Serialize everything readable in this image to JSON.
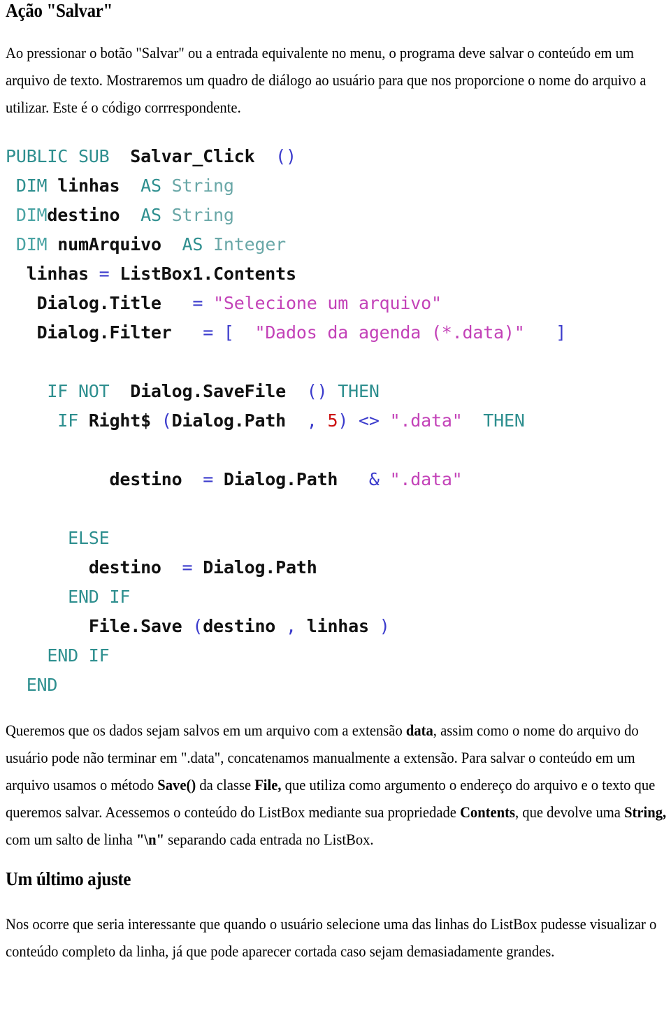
{
  "document": {
    "heading_1": "Ação \"Salvar\"",
    "heading_2": "Um último ajuste",
    "intro_paragraph": "Ao pressionar o botão \"Salvar\" ou a entrada equivalente no menu, o programa deve salvar o conteúdo em um arquivo de texto. Mostraremos um quadro de diálogo ao usuário para que nos proporcione o nome do arquivo a utilizar. Este é o código corrrespondente.",
    "closing_paragraph": "Nos ocorre que seria interessante que quando o usuário selecione uma das linhas do ListBox pudesse visualizar o conteúdo completo da linha, já que pode aparecer cortada caso sejam demasiadamente grandes."
  },
  "explanation": {
    "p1_a": "Queremos que os dados sejam salvos em um arquivo com a extensão ",
    "p1_b_bold": "data",
    "p1_c": ", assim como o nome do arquivo do usuário pode não terminar em \".data\", concatenamos manualmente a extensão. Para salvar o conteúdo em um arquivo usamos o método ",
    "p1_d_bold": "Save()",
    "p1_e": " da classe ",
    "p1_f_bold": "File,",
    "p1_g": " que utiliza como argumento o endereço do arquivo e o texto que queremos salvar. Acessemos o conteúdo do ListBox mediante sua propriedade ",
    "p1_h_bold": "Contents",
    "p1_i": ", que devolve uma ",
    "p1_j_bold": "String,",
    "p1_k": " com um salto de linha ",
    "p1_l_bold": "\"\\n\"",
    "p1_m": " separando cada entrada no ListBox."
  },
  "code": {
    "language": "Gambas Basic",
    "colors": {
      "keyword": "#2e8f8f",
      "keyword_light": "#49a3a3",
      "type": "#69a7a7",
      "identifier": "#111111",
      "operator": "#3b3bcc",
      "string": "#c342b8",
      "number": "#cc1111"
    },
    "lines": [
      {
        "id": "l1",
        "tokens": [
          {
            "t": "kw",
            "v": "PUBLIC SUB"
          },
          {
            "t": "sp",
            "v": "  "
          },
          {
            "t": "id",
            "v": "Salvar_Click"
          },
          {
            "t": "sp",
            "v": "  "
          },
          {
            "t": "op",
            "v": "()"
          }
        ]
      },
      {
        "id": "l2",
        "tokens": [
          {
            "t": "sp",
            "v": " "
          },
          {
            "t": "kw",
            "v": "DIM"
          },
          {
            "t": "sp",
            "v": " "
          },
          {
            "t": "id",
            "v": "linhas"
          },
          {
            "t": "sp",
            "v": "  "
          },
          {
            "t": "kw",
            "v": "AS"
          },
          {
            "t": "sp",
            "v": " "
          },
          {
            "t": "typ",
            "v": "String"
          }
        ]
      },
      {
        "id": "l3",
        "tokens": [
          {
            "t": "sp",
            "v": " "
          },
          {
            "t": "kw2",
            "v": "DIM"
          },
          {
            "t": "id",
            "v": "destino"
          },
          {
            "t": "sp",
            "v": "  "
          },
          {
            "t": "kw",
            "v": "AS"
          },
          {
            "t": "sp",
            "v": " "
          },
          {
            "t": "typ",
            "v": "String"
          }
        ]
      },
      {
        "id": "l4",
        "tokens": [
          {
            "t": "sp",
            "v": " "
          },
          {
            "t": "kw2",
            "v": "DIM"
          },
          {
            "t": "sp",
            "v": " "
          },
          {
            "t": "id",
            "v": "numArquivo"
          },
          {
            "t": "sp",
            "v": "  "
          },
          {
            "t": "kw",
            "v": "AS"
          },
          {
            "t": "sp",
            "v": " "
          },
          {
            "t": "typ",
            "v": "Integer"
          }
        ]
      },
      {
        "id": "l5",
        "tokens": [
          {
            "t": "sp",
            "v": "  "
          },
          {
            "t": "id",
            "v": "linhas"
          },
          {
            "t": "sp",
            "v": " "
          },
          {
            "t": "op",
            "v": "="
          },
          {
            "t": "sp",
            "v": " "
          },
          {
            "t": "id",
            "v": "ListBox1.Contents"
          }
        ]
      },
      {
        "id": "l6",
        "tokens": [
          {
            "t": "sp",
            "v": "   "
          },
          {
            "t": "id",
            "v": "Dialog.Title"
          },
          {
            "t": "sp",
            "v": "   "
          },
          {
            "t": "op",
            "v": "="
          },
          {
            "t": "sp",
            "v": " "
          },
          {
            "t": "str",
            "v": "\"Selecione um arquivo\""
          }
        ]
      },
      {
        "id": "l7",
        "tokens": [
          {
            "t": "sp",
            "v": "   "
          },
          {
            "t": "id",
            "v": "Dialog.Filter"
          },
          {
            "t": "sp",
            "v": "   "
          },
          {
            "t": "op",
            "v": "= ["
          },
          {
            "t": "sp",
            "v": "  "
          },
          {
            "t": "str",
            "v": "\"Dados da agenda (*.data)\""
          },
          {
            "t": "sp",
            "v": "   "
          },
          {
            "t": "op",
            "v": "]"
          }
        ]
      },
      {
        "id": "l8",
        "tokens": []
      },
      {
        "id": "l9",
        "tokens": [
          {
            "t": "sp",
            "v": "    "
          },
          {
            "t": "kw",
            "v": "IF NOT"
          },
          {
            "t": "sp",
            "v": "  "
          },
          {
            "t": "id",
            "v": "Dialog.SaveFile"
          },
          {
            "t": "sp",
            "v": "  "
          },
          {
            "t": "op",
            "v": "()"
          },
          {
            "t": "sp",
            "v": " "
          },
          {
            "t": "kw",
            "v": "THEN"
          }
        ]
      },
      {
        "id": "l10",
        "tokens": [
          {
            "t": "sp",
            "v": "     "
          },
          {
            "t": "kw",
            "v": "IF"
          },
          {
            "t": "sp",
            "v": " "
          },
          {
            "t": "id",
            "v": "Right$"
          },
          {
            "t": "sp",
            "v": " "
          },
          {
            "t": "op",
            "v": "("
          },
          {
            "t": "id",
            "v": "Dialog.Path"
          },
          {
            "t": "sp",
            "v": "  "
          },
          {
            "t": "op",
            "v": ","
          },
          {
            "t": "sp",
            "v": " "
          },
          {
            "t": "num",
            "v": "5"
          },
          {
            "t": "op",
            "v": ")"
          },
          {
            "t": "sp",
            "v": " "
          },
          {
            "t": "op",
            "v": "<>"
          },
          {
            "t": "sp",
            "v": " "
          },
          {
            "t": "str",
            "v": "\".data\""
          },
          {
            "t": "sp",
            "v": "  "
          },
          {
            "t": "kw",
            "v": "THEN"
          }
        ]
      },
      {
        "id": "l11",
        "tokens": []
      },
      {
        "id": "l12",
        "tokens": [
          {
            "t": "sp",
            "v": "          "
          },
          {
            "t": "id",
            "v": "destino"
          },
          {
            "t": "sp",
            "v": "  "
          },
          {
            "t": "op",
            "v": "="
          },
          {
            "t": "sp",
            "v": " "
          },
          {
            "t": "id",
            "v": "Dialog.Path"
          },
          {
            "t": "sp",
            "v": "   "
          },
          {
            "t": "op",
            "v": "&"
          },
          {
            "t": "sp",
            "v": " "
          },
          {
            "t": "str",
            "v": "\".data\""
          }
        ]
      },
      {
        "id": "l13",
        "tokens": []
      },
      {
        "id": "l14",
        "tokens": [
          {
            "t": "sp",
            "v": "      "
          },
          {
            "t": "kw",
            "v": "ELSE"
          }
        ]
      },
      {
        "id": "l15",
        "tokens": [
          {
            "t": "sp",
            "v": "        "
          },
          {
            "t": "id",
            "v": "destino"
          },
          {
            "t": "sp",
            "v": "  "
          },
          {
            "t": "op",
            "v": "="
          },
          {
            "t": "sp",
            "v": " "
          },
          {
            "t": "id",
            "v": "Dialog.Path"
          }
        ]
      },
      {
        "id": "l16",
        "tokens": [
          {
            "t": "sp",
            "v": "      "
          },
          {
            "t": "kw",
            "v": "END IF"
          }
        ]
      },
      {
        "id": "l17",
        "tokens": [
          {
            "t": "sp",
            "v": "        "
          },
          {
            "t": "id",
            "v": "File.Save"
          },
          {
            "t": "sp",
            "v": " "
          },
          {
            "t": "op",
            "v": "("
          },
          {
            "t": "id",
            "v": "destino"
          },
          {
            "t": "sp",
            "v": " "
          },
          {
            "t": "op",
            "v": ","
          },
          {
            "t": "sp",
            "v": " "
          },
          {
            "t": "id",
            "v": "linhas"
          },
          {
            "t": "sp",
            "v": " "
          },
          {
            "t": "op",
            "v": ")"
          }
        ]
      },
      {
        "id": "l18",
        "tokens": [
          {
            "t": "sp",
            "v": "    "
          },
          {
            "t": "kw",
            "v": "END IF"
          }
        ]
      },
      {
        "id": "l19",
        "tokens": [
          {
            "t": "sp",
            "v": "  "
          },
          {
            "t": "kw",
            "v": "END"
          }
        ]
      }
    ]
  }
}
